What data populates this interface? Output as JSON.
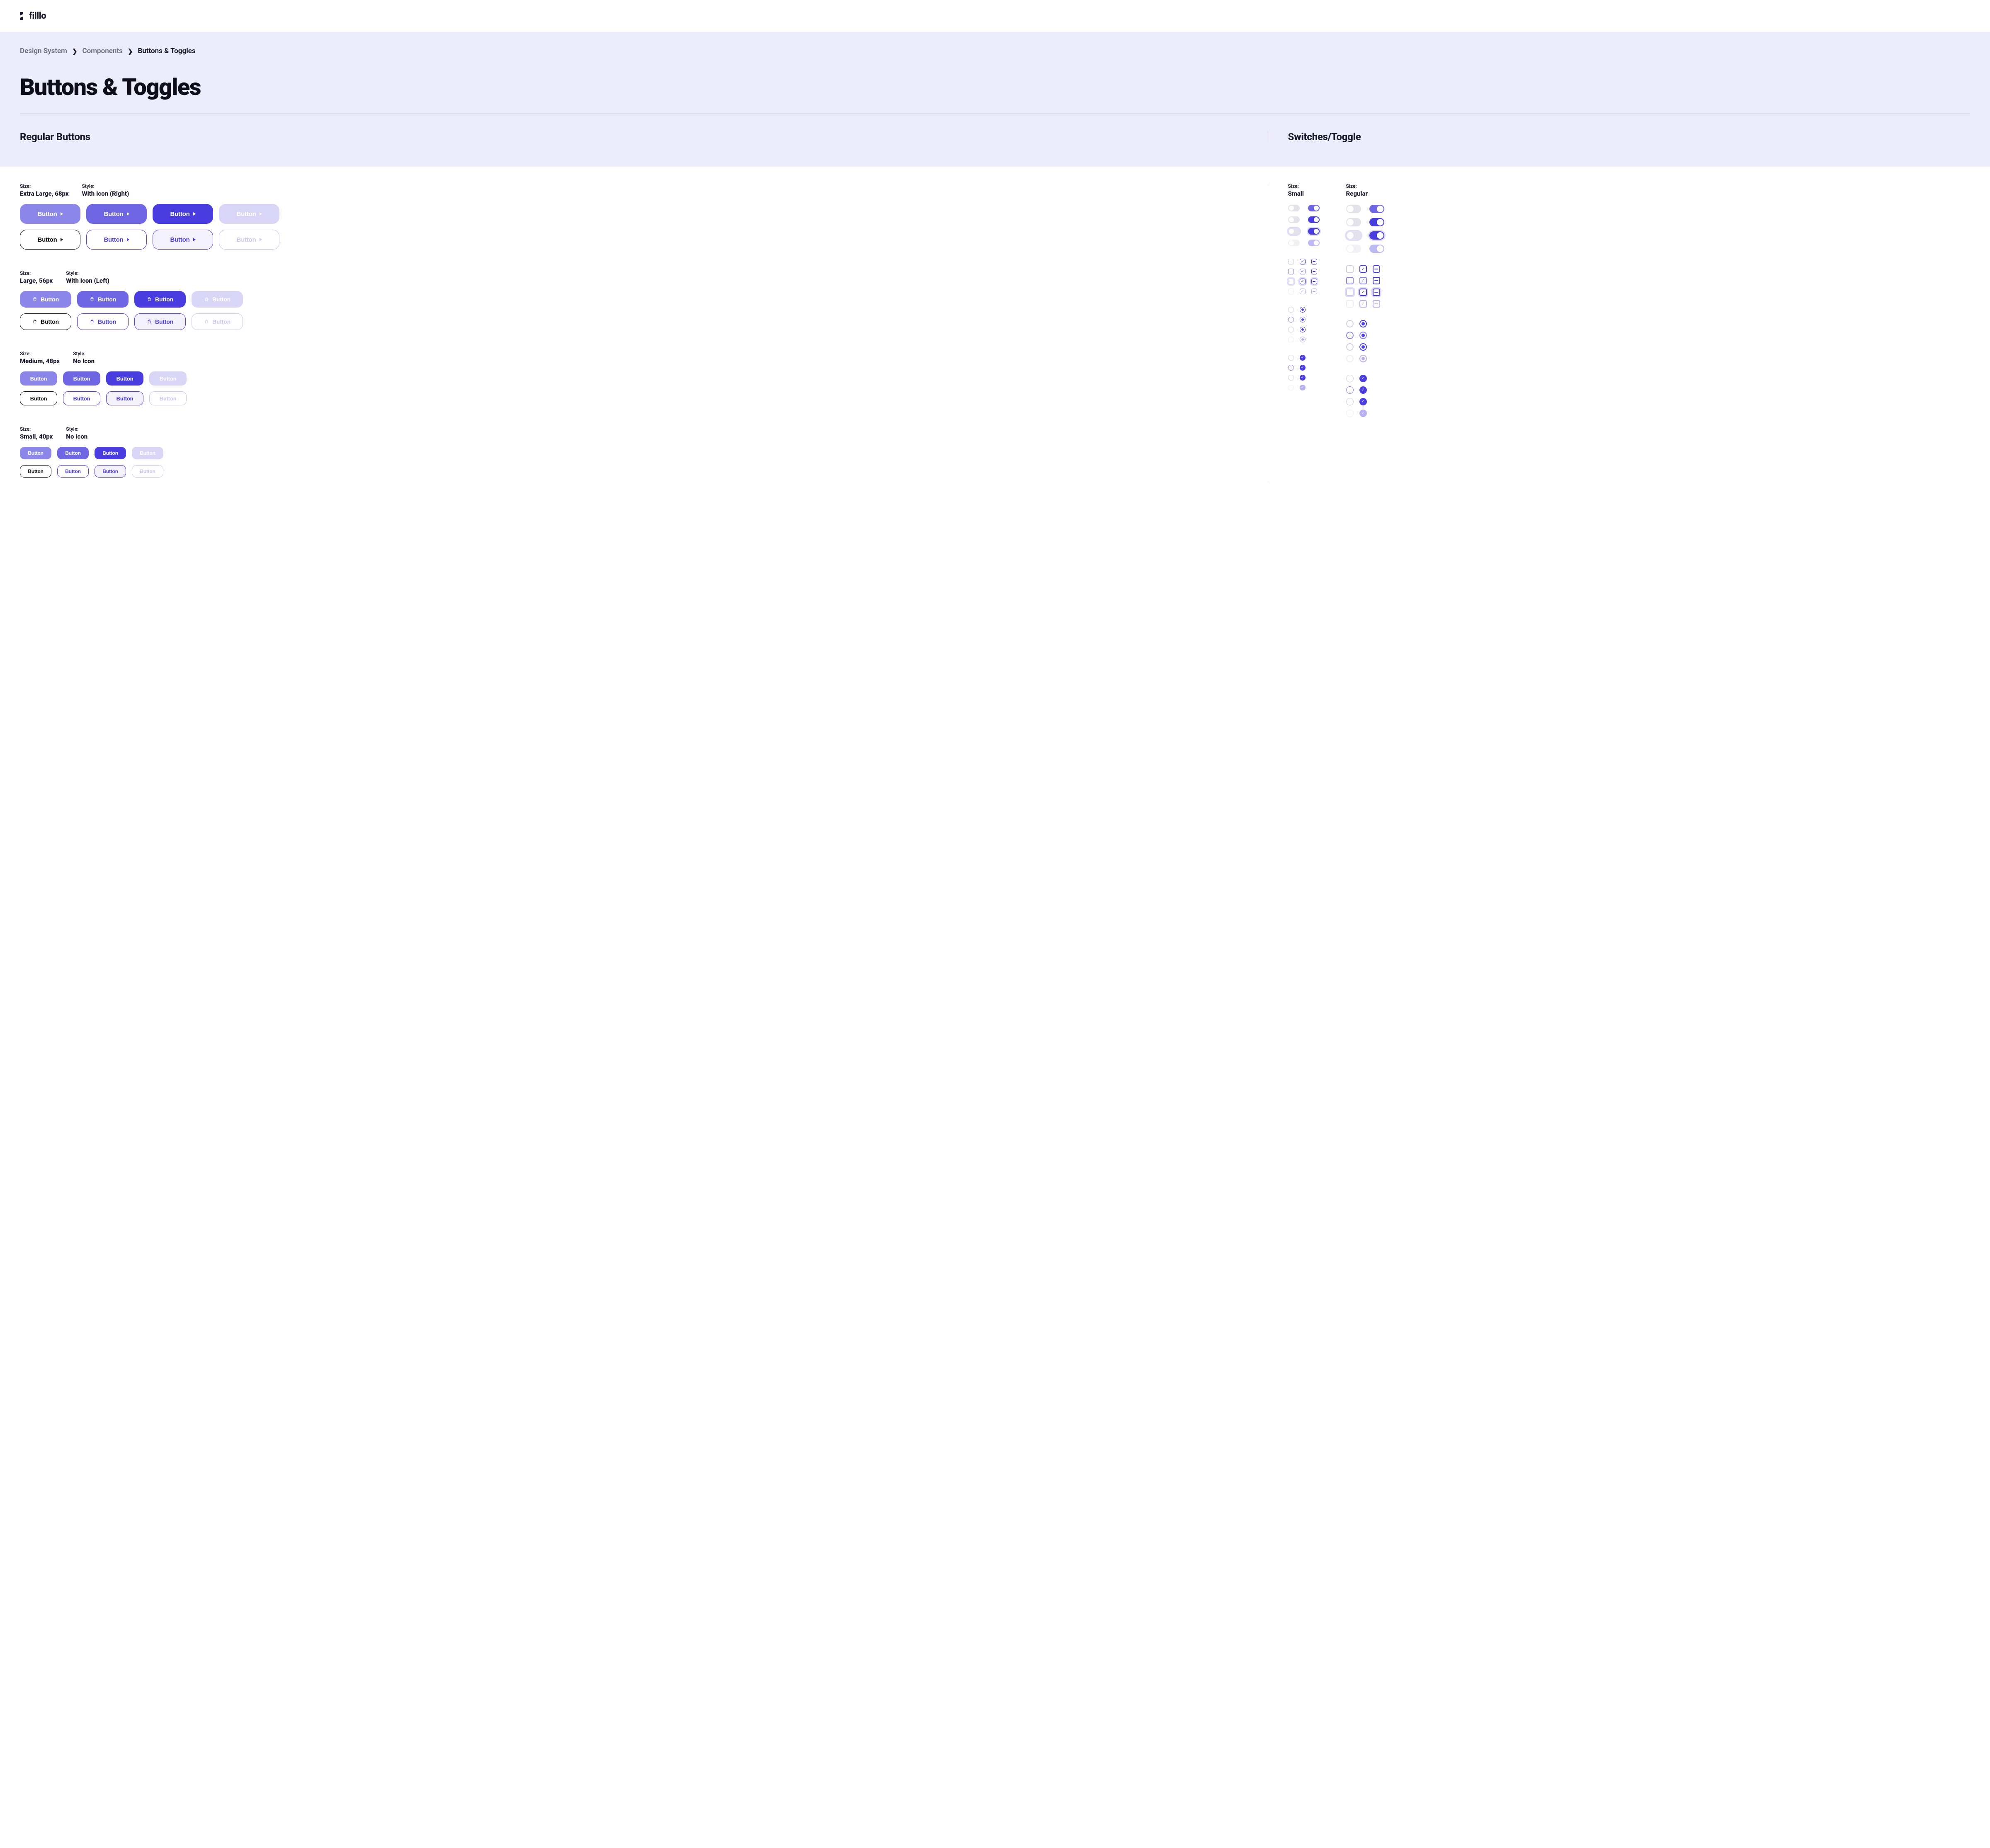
{
  "brand": "filllo",
  "breadcrumb": {
    "a": "Design System",
    "b": "Components",
    "c": "Buttons & Toggles"
  },
  "title": "Buttons & Toggles",
  "sections": {
    "buttons": "Regular Buttons",
    "toggles": "Switches/Toggle"
  },
  "labels": {
    "size": "Size:",
    "style": "Style:",
    "btn": "Button"
  },
  "buttonGroups": [
    {
      "size": "Extra Large, 68px",
      "style": "With Icon (Right)",
      "cls": "xl",
      "icon": "right"
    },
    {
      "size": "Large, 56px",
      "style": "With Icon (Left)",
      "cls": "lg",
      "icon": "left"
    },
    {
      "size": "Medium, 48px",
      "style": "No Icon",
      "cls": "md",
      "icon": "none"
    },
    {
      "size": "Small, 40px",
      "style": "No Icon",
      "cls": "sm",
      "icon": "none"
    }
  ],
  "toggleCols": [
    {
      "size": "Small",
      "cls": "sm"
    },
    {
      "size": "Regular",
      "cls": "rg"
    }
  ]
}
